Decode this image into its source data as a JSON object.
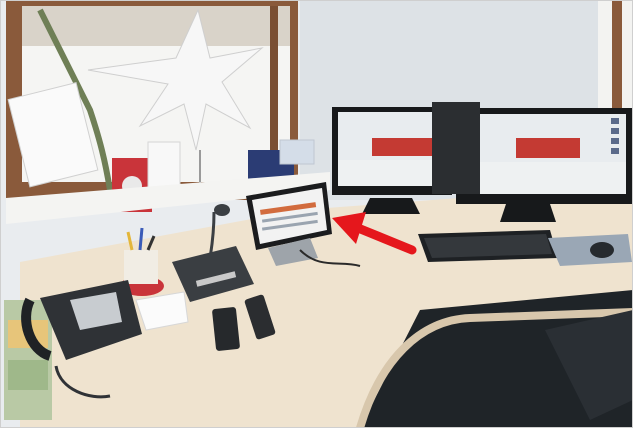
{
  "photo": {
    "subject": "office-desk-workstation",
    "colors": {
      "wall": "#e9ecef",
      "window_frame": "#8a5a3b",
      "window_glass": "#f5f5f3",
      "desk": "#efe3cf",
      "desk_edge": "#d8c7ac",
      "floor_dark": "#1f2428",
      "monitor": "#17191b",
      "screen_sky": "#e8ecef",
      "building_red": "#c43a33",
      "arrow": "#e5171c",
      "tablet_screen": "#f2f2f2"
    },
    "icons": [
      "window",
      "star-lamp",
      "pine-garland",
      "greeting-card",
      "christmas-ornament",
      "desk-lamp",
      "monitor-left",
      "monitor-right",
      "tablet",
      "arrow",
      "keyboard",
      "mouse",
      "mousepad",
      "desk-phone",
      "microphone-base",
      "mobile-phone",
      "remote-control",
      "pen-cup",
      "note-pad",
      "file-tray"
    ]
  }
}
